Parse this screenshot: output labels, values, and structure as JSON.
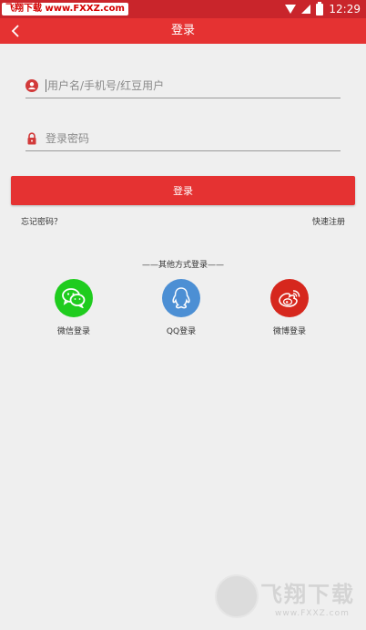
{
  "status_bar": {
    "watermark_text": "飞翔下载 www.FXXZ.com",
    "time": "12:29",
    "icons": [
      "wifi-icon",
      "signal-icon",
      "battery-icon"
    ]
  },
  "app_bar": {
    "title": "登录",
    "back_icon": "chevron-left-icon"
  },
  "form": {
    "username_placeholder": "用户名/手机号/红豆用户",
    "password_placeholder": "登录密码",
    "submit_label": "登录",
    "forgot_label": "忘记密码？",
    "register_label": "快速注册"
  },
  "social": {
    "title": "——其他方式登录——",
    "items": [
      {
        "label": "微信登录",
        "icon": "wechat-icon",
        "color": "#1fcc1e"
      },
      {
        "label": "QQ登录",
        "icon": "qq-icon",
        "color": "#4c8fd4"
      },
      {
        "label": "微博登录",
        "icon": "weibo-icon",
        "color": "#d6271d"
      }
    ]
  },
  "watermark": {
    "title": "飞翔下载",
    "url": "www.FXXZ.com"
  },
  "colors": {
    "accent": "#e53232",
    "status_bar": "#c9252b",
    "background": "#efefef"
  }
}
